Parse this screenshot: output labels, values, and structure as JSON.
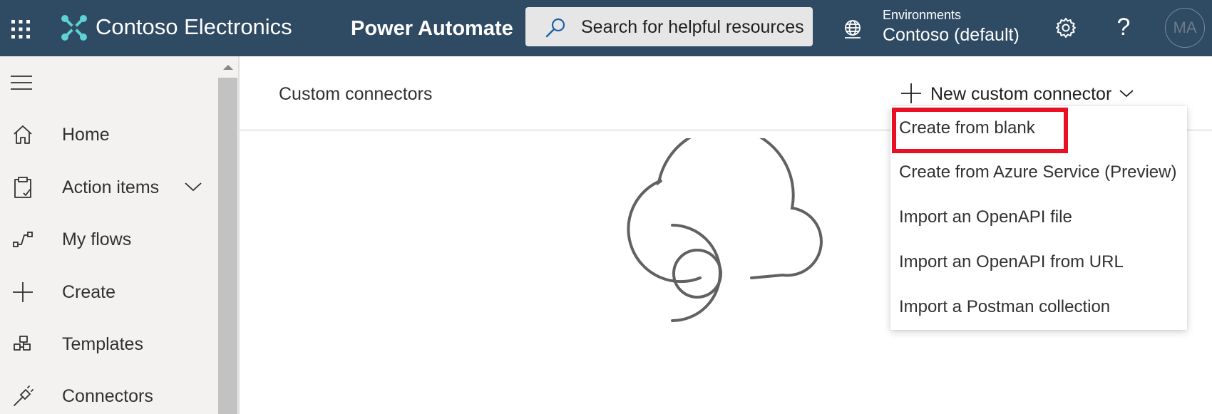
{
  "topbar": {
    "brand": "Contoso Electronics",
    "app_name": "Power Automate",
    "search_placeholder": "Search for helpful resources",
    "env_label": "Environments",
    "env_value": "Contoso (default)",
    "help_label": "?",
    "avatar_initials": "MA",
    "bg_color": "#2f4a63"
  },
  "sidebar": {
    "items": [
      {
        "label": "Home",
        "icon": "home-icon"
      },
      {
        "label": "Action items",
        "icon": "clipboard-check-icon",
        "expandable": true
      },
      {
        "label": "My flows",
        "icon": "flow-icon"
      },
      {
        "label": "Create",
        "icon": "plus-icon"
      },
      {
        "label": "Templates",
        "icon": "templates-icon"
      },
      {
        "label": "Connectors",
        "icon": "connector-plug-icon"
      }
    ]
  },
  "main": {
    "title": "Custom connectors",
    "new_button_label": "New custom connector"
  },
  "menu": {
    "items": [
      {
        "label": "Create from blank",
        "highlighted": true
      },
      {
        "label": "Create from Azure Service (Preview)"
      },
      {
        "label": "Import an OpenAPI file"
      },
      {
        "label": "Import an OpenAPI from URL"
      },
      {
        "label": "Import a Postman collection"
      }
    ],
    "highlight_color": "#e81123"
  }
}
